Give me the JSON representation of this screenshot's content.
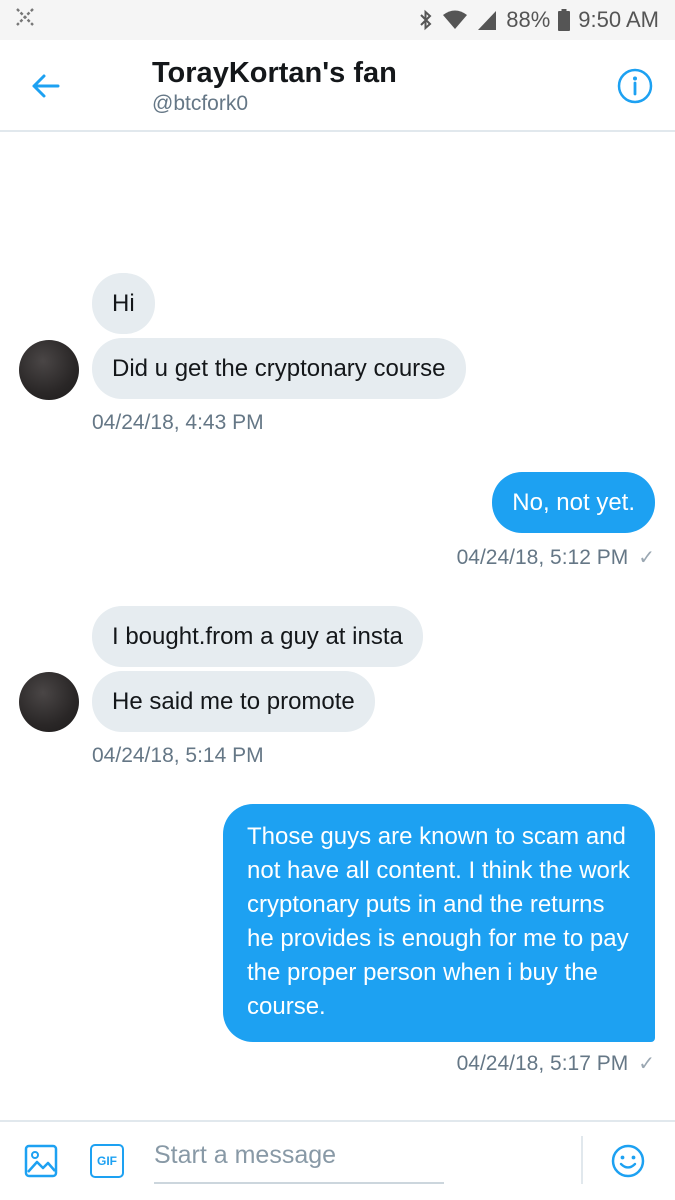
{
  "status_bar": {
    "left_icon": "notification-x-icon",
    "battery": "88%",
    "time": "9:50 AM",
    "icons": [
      "bluetooth-icon",
      "wifi-icon",
      "cell-signal-icon",
      "battery-icon"
    ]
  },
  "header": {
    "title": "TorayKortan's fan",
    "handle": "@btcfork0",
    "back_icon": "back-arrow-icon",
    "info_icon": "info-icon"
  },
  "conversation": {
    "group1": {
      "messages": [
        "Hi",
        "Did u get the cryptonary course"
      ],
      "timestamp": "04/24/18, 4:43 PM"
    },
    "reply1": {
      "message": "No, not yet.",
      "timestamp": "04/24/18, 5:12 PM",
      "read_mark": "✓"
    },
    "group2": {
      "messages": [
        "I bought.from a guy at insta",
        "He said me to promote"
      ],
      "timestamp": "04/24/18, 5:14 PM"
    },
    "reply2": {
      "message": "Those guys are known to scam and not have all content. I think the work cryptonary puts in and the returns he provides is enough for me to pay the proper person when i buy the course.",
      "timestamp": "04/24/18, 5:17 PM",
      "read_mark": "✓"
    }
  },
  "compose": {
    "placeholder": "Start a message",
    "gif_label": "GIF",
    "icons": [
      "image-icon",
      "gif-icon",
      "emoji-icon"
    ]
  },
  "colors": {
    "accent": "#1da1f2",
    "incoming_bubble": "#e6ecf0",
    "secondary_text": "#657786"
  }
}
